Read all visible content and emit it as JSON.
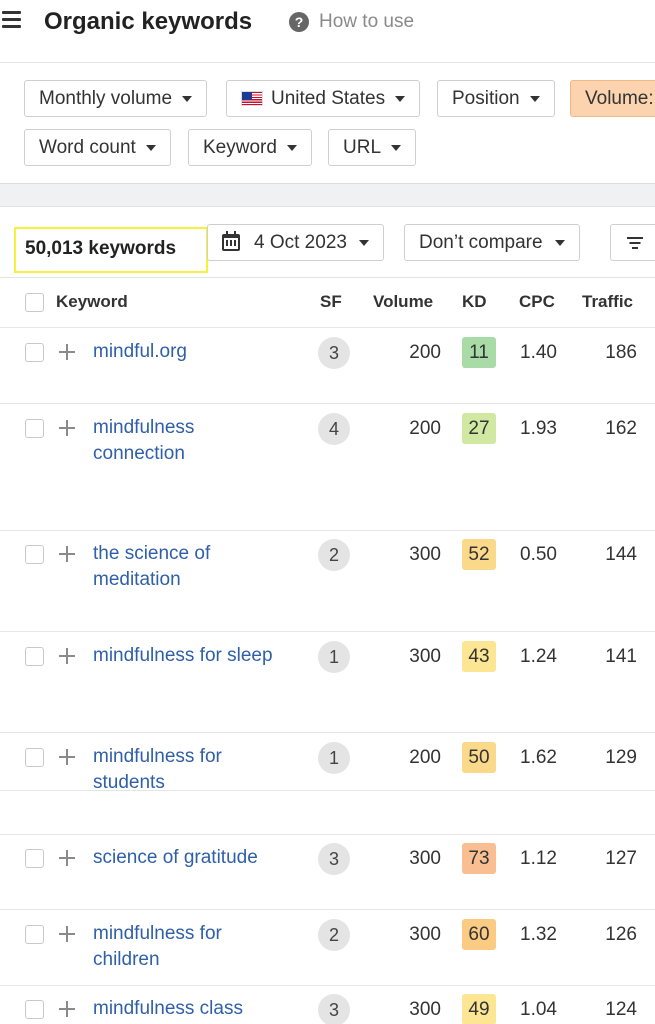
{
  "header": {
    "title": "Organic keywords",
    "help_label": "How to use",
    "help_icon_glyph": "?"
  },
  "filters": {
    "row1": [
      "Monthly volume",
      "United States",
      "Position",
      "Volume:"
    ],
    "row2": [
      "Word count",
      "Keyword",
      "URL"
    ]
  },
  "results": {
    "count": "50,013 keywords",
    "date": "4 Oct 2023",
    "compare": "Don’t compare"
  },
  "table": {
    "headers": {
      "keyword": "Keyword",
      "sf": "SF",
      "volume": "Volume",
      "kd": "KD",
      "cpc": "CPC",
      "traffic": "Traffic"
    },
    "rows": [
      {
        "keyword": "mindful.org",
        "sf": "3",
        "volume": "200",
        "kd": "11",
        "kd_color": "#a9dba6",
        "cpc": "1.40",
        "traffic": "186"
      },
      {
        "keyword": "mindfulness connection",
        "sf": "4",
        "volume": "200",
        "kd": "27",
        "kd_color": "#d0e8a2",
        "cpc": "1.93",
        "traffic": "162"
      },
      {
        "keyword": "the science of meditation",
        "sf": "2",
        "volume": "300",
        "kd": "52",
        "kd_color": "#fbd98a",
        "cpc": "0.50",
        "traffic": "144"
      },
      {
        "keyword": "mindfulness for sleep",
        "sf": "1",
        "volume": "300",
        "kd": "43",
        "kd_color": "#fce593",
        "cpc": "1.24",
        "traffic": "141"
      },
      {
        "keyword": "mindfulness for students",
        "sf": "1",
        "volume": "200",
        "kd": "50",
        "kd_color": "#fbd98a",
        "cpc": "1.62",
        "traffic": "129"
      },
      {
        "keyword": "science of gratitude",
        "sf": "3",
        "volume": "300",
        "kd": "73",
        "kd_color": "#f9bf93",
        "cpc": "1.12",
        "traffic": "127"
      },
      {
        "keyword": "mindfulness for children",
        "sf": "2",
        "volume": "300",
        "kd": "60",
        "kd_color": "#fbcb84",
        "cpc": "1.32",
        "traffic": "126"
      },
      {
        "keyword": "mindfulness class",
        "sf": "3",
        "volume": "300",
        "kd": "49",
        "kd_color": "#fce593",
        "cpc": "1.04",
        "traffic": "124"
      }
    ]
  },
  "colors": {
    "link": "#2f5fa8",
    "active_filter": "#fbd3ae",
    "highlight_box": "#f4f23a"
  }
}
